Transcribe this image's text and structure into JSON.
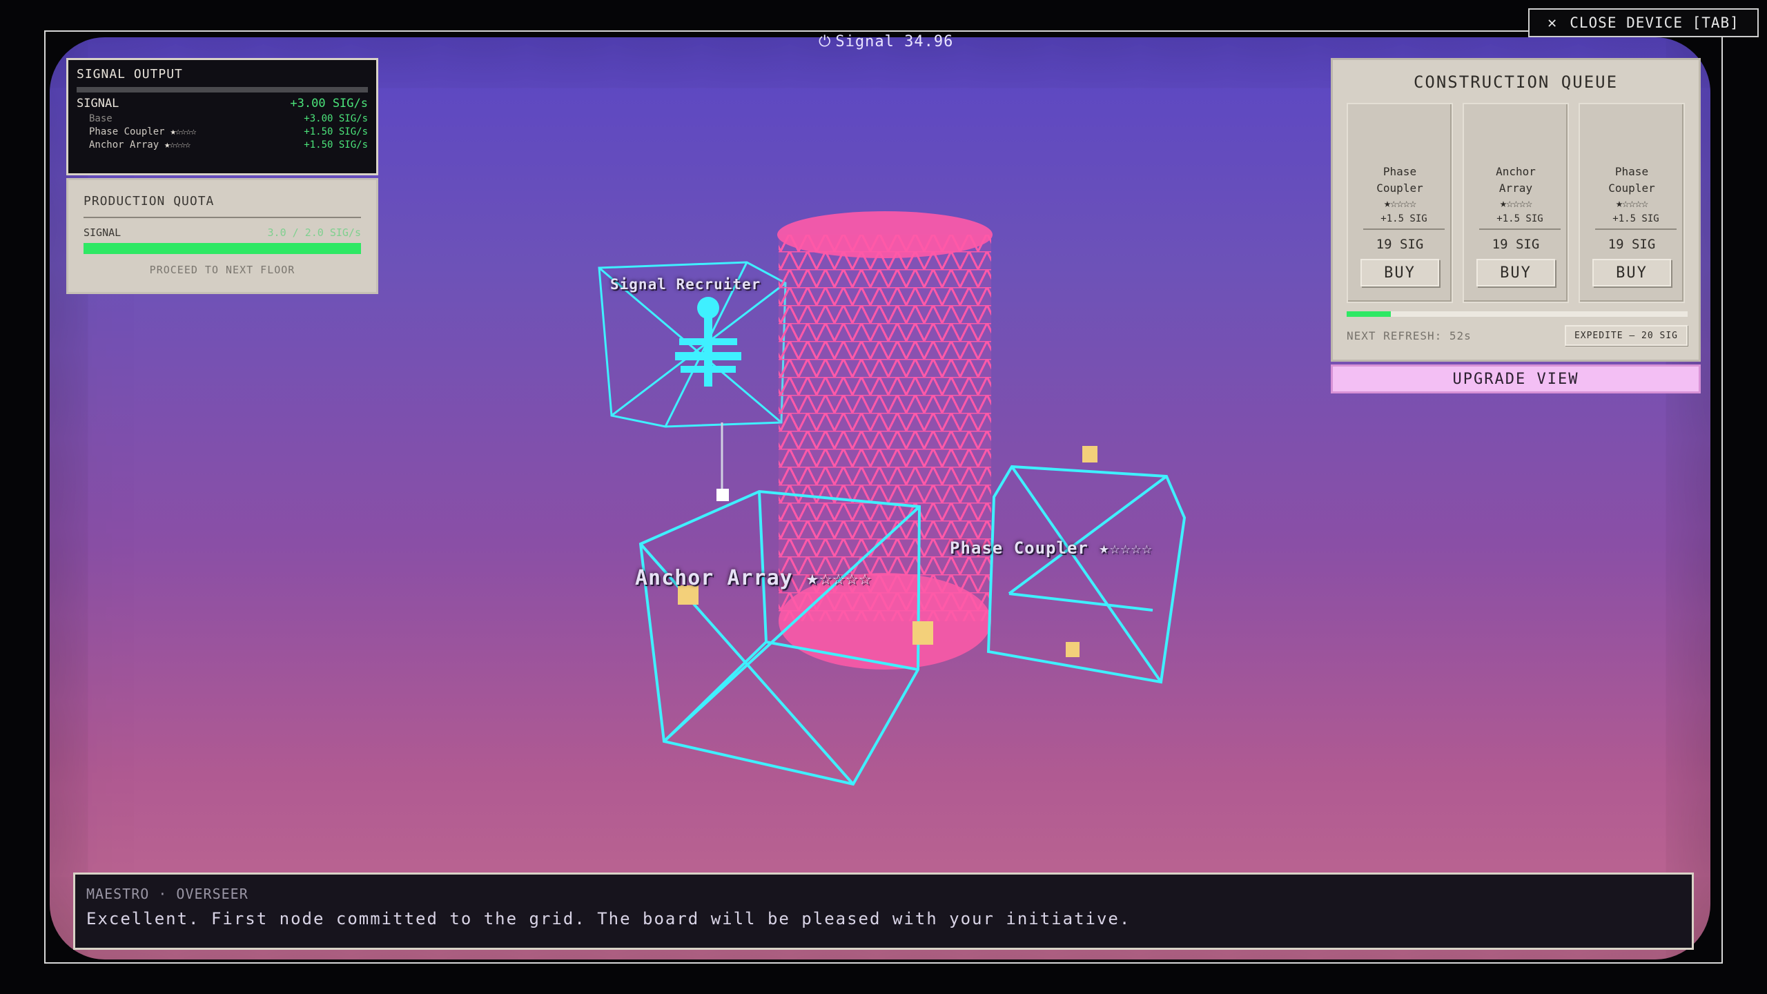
{
  "hud": {
    "signal_icon": "power-icon",
    "signal_readout": "Signal 34.96",
    "close_button": "CLOSE DEVICE  [TAB]"
  },
  "signal_output": {
    "title": "SIGNAL OUTPUT",
    "main_label": "SIGNAL",
    "main_value": "+3.00 SIG/s",
    "rows": [
      {
        "name": "Base",
        "stars": "",
        "value": "+3.00 SIG/s"
      },
      {
        "name": "Phase Coupler",
        "stars": "★☆☆☆☆",
        "value": "+1.50 SIG/s"
      },
      {
        "name": "Anchor Array",
        "stars": "★☆☆☆☆",
        "value": "+1.50 SIG/s"
      }
    ]
  },
  "quota": {
    "title": "PRODUCTION QUOTA",
    "label": "SIGNAL",
    "value": "3.0 / 2.0 SIG/s",
    "progress": 1.0,
    "proceed": "PROCEED TO NEXT FLOOR"
  },
  "queue": {
    "title": "CONSTRUCTION QUEUE",
    "cards": [
      {
        "name_line1": "Phase",
        "name_line2": "Coupler",
        "stars": "★☆☆☆☆",
        "bonus": "+1.5 SIG",
        "price": "19 SIG",
        "buy": "BUY"
      },
      {
        "name_line1": "Anchor",
        "name_line2": "Array",
        "stars": "★☆☆☆☆",
        "bonus": "+1.5 SIG",
        "price": "19 SIG",
        "buy": "BUY"
      },
      {
        "name_line1": "Phase",
        "name_line2": "Coupler",
        "stars": "★☆☆☆☆",
        "bonus": "+1.5 SIG",
        "price": "19 SIG",
        "buy": "BUY"
      }
    ],
    "refresh_progress": 0.13,
    "next_refresh": "NEXT REFRESH: 52s",
    "expedite": "EXPEDITE — 20 SIG",
    "upgrade_view": "UPGRADE VIEW"
  },
  "scene": {
    "label_recruiter": "Signal Recruiter",
    "label_anchor": "Anchor Array",
    "label_anchor_stars": "★☆☆☆☆",
    "label_phase": "Phase Coupler",
    "label_phase_stars": "★☆☆☆☆",
    "colors": {
      "wireframe": "#3ff0ff",
      "tower": "#ff5aa8",
      "cube_marker": "#f3d07a"
    }
  },
  "dialogue": {
    "speaker": "MAESTRO · OVERSEER",
    "line": "Excellent. First node committed to the grid. The board will be pleased with your initiative."
  }
}
